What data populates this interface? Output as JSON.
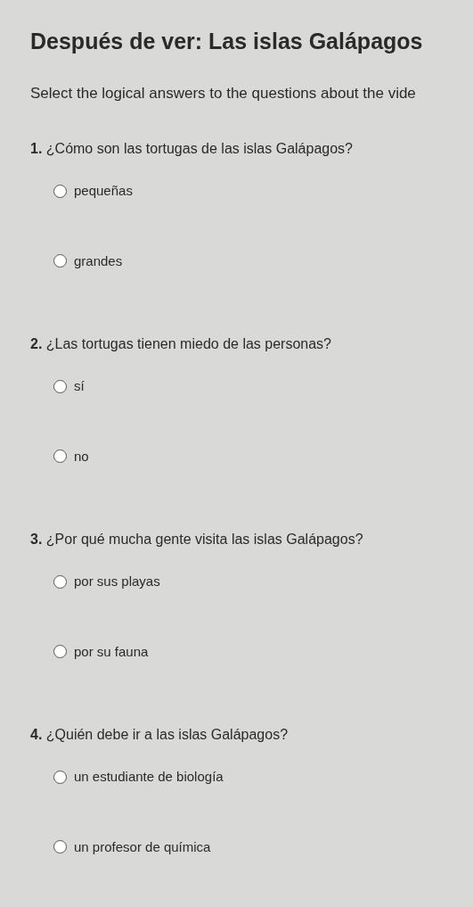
{
  "title": "Después de ver: Las islas Galápagos",
  "instructions": "Select the logical answers to the questions about the vide",
  "questions": [
    {
      "number": "1.",
      "text": "¿Cómo son las tortugas de las islas Galápagos?",
      "options": [
        {
          "label": "pequeñas",
          "selected": false
        },
        {
          "label": "grandes",
          "selected": false
        }
      ]
    },
    {
      "number": "2.",
      "text": "¿Las tortugas tienen miedo de las personas?",
      "options": [
        {
          "label": "sí",
          "selected": false
        },
        {
          "label": "no",
          "selected": false
        }
      ]
    },
    {
      "number": "3.",
      "text": "¿Por qué mucha gente visita las islas Galápagos?",
      "options": [
        {
          "label": "por sus playas",
          "selected": false
        },
        {
          "label": "por su fauna",
          "selected": false
        }
      ]
    },
    {
      "number": "4.",
      "text": "¿Quién debe ir a las islas Galápagos?",
      "options": [
        {
          "label": "un estudiante de biología",
          "selected": false
        },
        {
          "label": "un profesor de química",
          "selected": false
        }
      ]
    }
  ]
}
